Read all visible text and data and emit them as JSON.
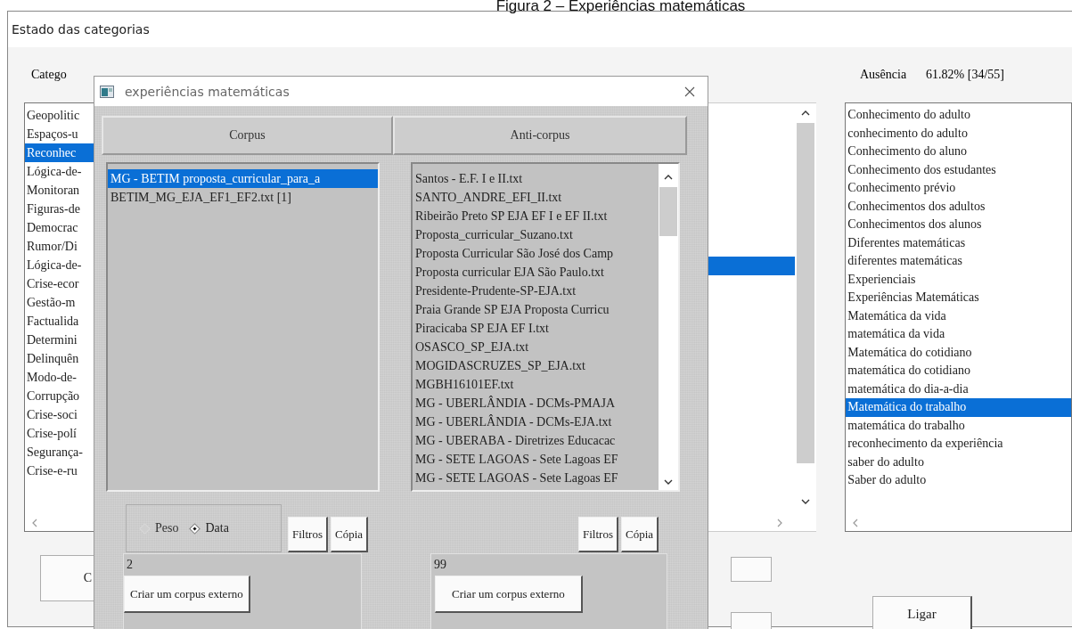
{
  "caption": "Figura 2 – Experiências matemáticas",
  "window": {
    "title": "Estado das categorias"
  },
  "headers": {
    "left": "Catego",
    "right_label": "Ausência",
    "right_value": "61.82% [34/55]"
  },
  "left_list": {
    "items": [
      {
        "label": "Geopolitic",
        "selected": false
      },
      {
        "label": "Espaços-u",
        "selected": false
      },
      {
        "label": "Reconhec",
        "selected": true
      },
      {
        "label": "Lógica-de-",
        "selected": false
      },
      {
        "label": "Monitoran",
        "selected": false
      },
      {
        "label": "Figuras-de",
        "selected": false
      },
      {
        "label": "Democrac",
        "selected": false
      },
      {
        "label": "Rumor/Di",
        "selected": false
      },
      {
        "label": "Lógica-de-",
        "selected": false
      },
      {
        "label": "Crise-ecor",
        "selected": false
      },
      {
        "label": "Gestão-m",
        "selected": false
      },
      {
        "label": "Factualida",
        "selected": false
      },
      {
        "label": "Determini",
        "selected": false
      },
      {
        "label": "Delinquên",
        "selected": false
      },
      {
        "label": "Modo-de-",
        "selected": false
      },
      {
        "label": "Corrupção",
        "selected": false
      },
      {
        "label": "Crise-soci",
        "selected": false
      },
      {
        "label": "Crise-polí",
        "selected": false
      },
      {
        "label": "Segurança-",
        "selected": false
      },
      {
        "label": "Crise-e-ru",
        "selected": false
      }
    ]
  },
  "middle_list": {
    "rows": [
      {
        "selected": false
      },
      {
        "selected": false
      },
      {
        "selected": false
      },
      {
        "selected": false
      },
      {
        "selected": false
      },
      {
        "selected": false
      },
      {
        "selected": false
      },
      {
        "selected": false
      },
      {
        "selected": true
      }
    ]
  },
  "right_list": {
    "items": [
      {
        "label": "Conhecimento do adulto",
        "selected": false
      },
      {
        "label": "conhecimento do adulto",
        "selected": false
      },
      {
        "label": "Conhecimento do aluno",
        "selected": false
      },
      {
        "label": "Conhecimento dos estudantes",
        "selected": false
      },
      {
        "label": "Conhecimento prévio",
        "selected": false
      },
      {
        "label": "Conhecimentos dos adultos",
        "selected": false
      },
      {
        "label": "Conhecimentos dos alunos",
        "selected": false
      },
      {
        "label": "Diferentes matemáticas",
        "selected": false
      },
      {
        "label": "diferentes matemáticas",
        "selected": false
      },
      {
        "label": "Experienciais",
        "selected": false
      },
      {
        "label": "Experiências Matemáticas",
        "selected": false
      },
      {
        "label": "Matemática da vida",
        "selected": false
      },
      {
        "label": "matemática da vida",
        "selected": false
      },
      {
        "label": "Matemática do cotidiano",
        "selected": false
      },
      {
        "label": "matemática do cotidiano",
        "selected": false
      },
      {
        "label": "matemática do dia-a-dia",
        "selected": false
      },
      {
        "label": "Matemática do trabalho",
        "selected": true
      },
      {
        "label": "matemática do trabalho",
        "selected": false
      },
      {
        "label": "reconhecimento da experiência",
        "selected": false
      },
      {
        "label": "saber do adulto",
        "selected": false
      },
      {
        "label": "Saber do adulto",
        "selected": false
      }
    ]
  },
  "bottom": {
    "partial_button": "C",
    "action_button": "Ligar"
  },
  "dialog": {
    "title": "experiências matemáticas",
    "radios": [
      {
        "label": "Peso",
        "selected": false,
        "disabled": true
      },
      {
        "label": "Data",
        "selected": true,
        "disabled": false
      }
    ],
    "corpus": {
      "header": "Corpus",
      "filter_button": "Filtros",
      "copy_button": "Cópia",
      "count": "2",
      "create_button": "Criar um corpus externo",
      "items": [
        {
          "label": "MG - BETIM proposta_curricular_para_a",
          "selected": true
        },
        {
          "label": "BETIM_MG_EJA_EF1_EF2.txt [1]",
          "selected": false
        }
      ]
    },
    "anti": {
      "header": "Anti-corpus",
      "filter_button": "Filtros",
      "copy_button": "Cópia",
      "count": "99",
      "create_button": "Criar um corpus externo",
      "items": [
        {
          "label": "Santos - E.F. I e II.txt",
          "selected": false
        },
        {
          "label": "SANTO_ANDRE_EFI_II.txt",
          "selected": false
        },
        {
          "label": "Ribeirão Preto SP EJA EF I e EF II.txt",
          "selected": false
        },
        {
          "label": "Proposta_curricular_Suzano.txt",
          "selected": false
        },
        {
          "label": "Proposta Curricular São José dos Camp",
          "selected": false
        },
        {
          "label": "Proposta curricular EJA São Paulo.txt",
          "selected": false
        },
        {
          "label": "Presidente-Prudente-SP-EJA.txt",
          "selected": false
        },
        {
          "label": "Praia Grande SP EJA Proposta Curricu",
          "selected": false
        },
        {
          "label": "Piracicaba SP EJA EF I.txt",
          "selected": false
        },
        {
          "label": "OSASCO_SP_EJA.txt",
          "selected": false
        },
        {
          "label": "MOGIDASCRUZES_SP_EJA.txt",
          "selected": false
        },
        {
          "label": "MGBH16101EF.txt",
          "selected": false
        },
        {
          "label": "MG - UBERLÂNDIA - DCMs-PMAJA",
          "selected": false
        },
        {
          "label": "MG - UBERLÂNDIA - DCMs-EJA.txt",
          "selected": false
        },
        {
          "label": "MG - UBERABA - Diretrizes Educacac",
          "selected": false
        },
        {
          "label": "MG - SETE LAGOAS - Sete Lagoas EF",
          "selected": false
        },
        {
          "label": "MG - SETE LAGOAS - Sete Lagoas EF",
          "selected": false
        }
      ]
    }
  }
}
